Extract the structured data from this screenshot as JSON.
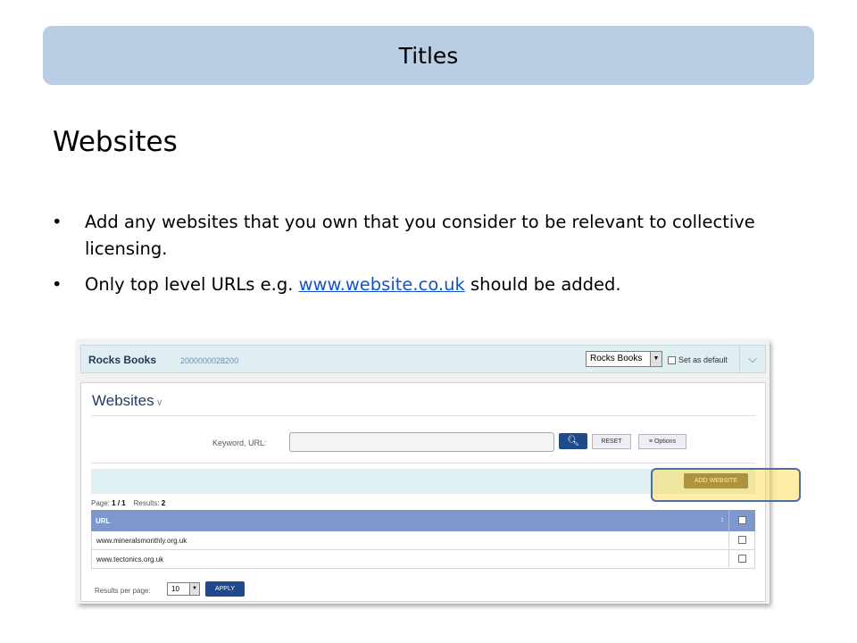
{
  "slide": {
    "title": "Titles",
    "heading": "Websites",
    "bullet_symbol": "•",
    "bullets": [
      {
        "text": "Add any websites that you own that you consider to be relevant to collective licensing."
      },
      {
        "text_before": "Only top level URLs e.g. ",
        "link": "www.website.co.uk",
        "text_after": " should be added."
      }
    ]
  },
  "account_bar": {
    "name": "Rocks Books",
    "id": "2000000028200",
    "selected_account": "Rocks Books",
    "set_default_label": "Set as default",
    "collapse_icon": "chevron-down-icon"
  },
  "websites_panel": {
    "title": "Websites",
    "title_icon": "chevron-down-icon",
    "search": {
      "label": "Keyword, URL:",
      "value": "",
      "search_icon": "search-icon",
      "reset_label": "RESET",
      "options_label": "Options",
      "options_icon": "list-icon"
    },
    "add_button_label": "ADD WEBSITE",
    "pager": {
      "page_label": "Page:",
      "page": "1 / 1",
      "results_label": "Results:",
      "results": "2"
    },
    "table": {
      "columns": [
        "URL"
      ],
      "rows": [
        {
          "url": "www.mineralsmonthly.org.uk"
        },
        {
          "url": "www.tectonics.org.uk"
        }
      ]
    },
    "results_per_page_label": "Results per page:",
    "results_per_page": "10",
    "apply_label": "APPLY"
  },
  "colors": {
    "title_bar": "#b9cde5",
    "grid_header": "#7e97cc",
    "primary_button": "#1e4a8c",
    "add_button": "#6b5b44",
    "highlight_fill": "#ffd73c",
    "highlight_border": "#4a6fa0"
  }
}
